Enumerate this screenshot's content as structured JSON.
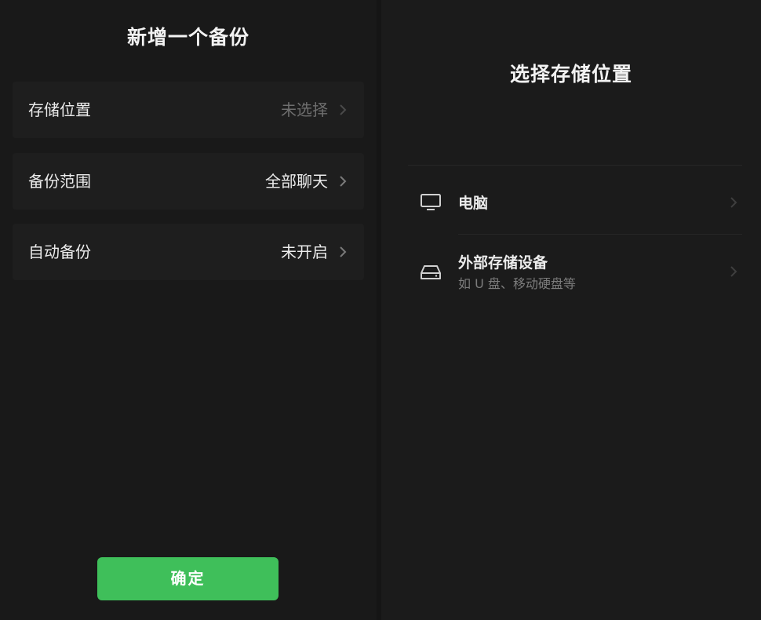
{
  "left_panel": {
    "title": "新增一个备份",
    "rows": [
      {
        "label": "存储位置",
        "value": "未选择",
        "value_muted": true
      },
      {
        "label": "备份范围",
        "value": "全部聊天",
        "value_muted": false
      },
      {
        "label": "自动备份",
        "value": "未开启",
        "value_muted": false
      }
    ],
    "confirm_label": "确定"
  },
  "right_panel": {
    "title": "选择存储位置",
    "options": [
      {
        "icon": "monitor-icon",
        "title": "电脑",
        "subtitle": ""
      },
      {
        "icon": "hard-drive-icon",
        "title": "外部存储设备",
        "subtitle": "如 U 盘、移动硬盘等"
      }
    ]
  },
  "colors": {
    "background": "#1a1a1a",
    "row_background": "#1e1e1e",
    "accent_green": "#3fbf5a",
    "muted_text": "#6e6e6e"
  }
}
